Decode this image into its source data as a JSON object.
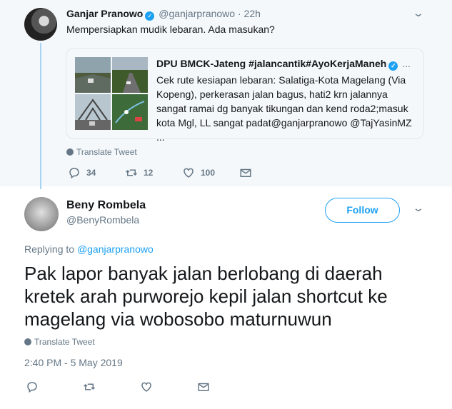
{
  "parent_tweet": {
    "name": "Ganjar Pranowo",
    "handle": "@ganjarpranowo",
    "separator": "·",
    "time": "22h",
    "text": "Mempersiapkan mudik lebaran. Ada masukan?",
    "quote": {
      "header": "DPU BMCK-Jateng #jalancantik#AyoKerjaManeh",
      "header_suffix": "...",
      "text": "Cek rute kesiapan lebaran: Salatiga-Kota Magelang (Via Kopeng), perkerasan jalan bagus, hati2 krn jalannya sangat ramai dg banyak tikungan dan kend roda2;masuk kota Mgl, LL sangat padat@ganjarpranowo @TajYasinMZ ..."
    },
    "translate_label": "Translate Tweet",
    "actions": {
      "replies": "34",
      "retweets": "12",
      "likes": "100"
    }
  },
  "reply_tweet": {
    "name": "Beny Rombela",
    "handle": "@BenyRombela",
    "follow_label": "Follow",
    "replying_prefix": "Replying to",
    "replying_handle": "@ganjarpranowo",
    "text": "Pak lapor banyak jalan berlobang di daerah kretek arah purworejo kepil jalan shortcut ke magelang via wobosobo maturnuwun",
    "translate_label": "Translate Tweet",
    "timestamp": "2:40 PM - 5 May 2019"
  },
  "icons": {
    "verified": "verified-badge-icon",
    "chevron": "chevron-down-icon",
    "reply": "reply-icon",
    "retweet": "retweet-icon",
    "like": "heart-icon",
    "dm": "envelope-icon",
    "globe": "globe-icon"
  },
  "colors": {
    "accent": "#1da1f2",
    "muted": "#657786",
    "parent_bg": "#f5f8fa",
    "thread_line": "#a6d3f2"
  }
}
